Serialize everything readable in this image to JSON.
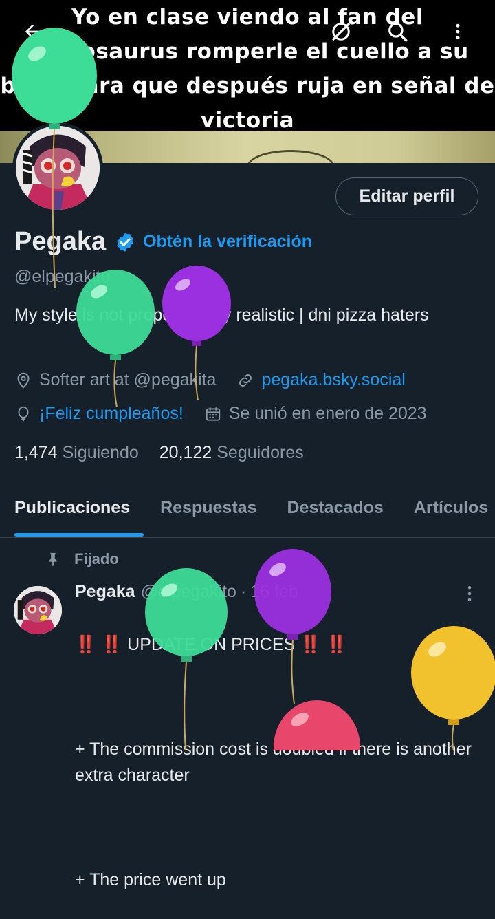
{
  "banner": {
    "caption": "Yo en clase viendo al fan del Spinosaurus romperle el cuello a su bully para que después ruja en señal de victoria"
  },
  "top_actions": {
    "back_icon": "arrow-left-icon",
    "grok_icon": "grok-icon",
    "search_icon": "search-icon",
    "more_icon": "more-vertical-icon"
  },
  "profile": {
    "edit_button": "Editar perfil",
    "name": "Pegaka",
    "verify_cta": "Obtén la verificación",
    "handle": "@elpegakito",
    "bio": "My style is not proportionally realistic | dni pizza haters",
    "location": "Softer art at @pegakita",
    "website": "pegaka.bsky.social",
    "birthday": "¡Feliz cumpleaños!",
    "joined": "Se unió en enero de 2023",
    "following_count": "1,474",
    "following_label": "Siguiendo",
    "followers_count": "20,122",
    "followers_label": "Seguidores"
  },
  "tabs": [
    {
      "label": "Publicaciones",
      "active": true
    },
    {
      "label": "Respuestas",
      "active": false
    },
    {
      "label": "Destacados",
      "active": false
    },
    {
      "label": "Artículos",
      "active": false
    }
  ],
  "post": {
    "pinned_label": "Fijado",
    "author_name": "Pegaka",
    "author_handle": "@elpegakito",
    "separator": "·",
    "date": "16 feb",
    "emoji_marks": "‼️ ‼️",
    "title": "UPDATE ON PRICES",
    "line1": "+ The commission cost is doubled if there is another extra character",
    "line2": "+ The price went up"
  },
  "colors": {
    "background": "#15202b",
    "accent_blue": "#1d9bf0",
    "muted_text": "#8b98a5",
    "balloon_green": "#3ddc97",
    "balloon_purple": "#9b30e0",
    "balloon_yellow": "#f2c12e",
    "balloon_pink": "#e8466a"
  }
}
